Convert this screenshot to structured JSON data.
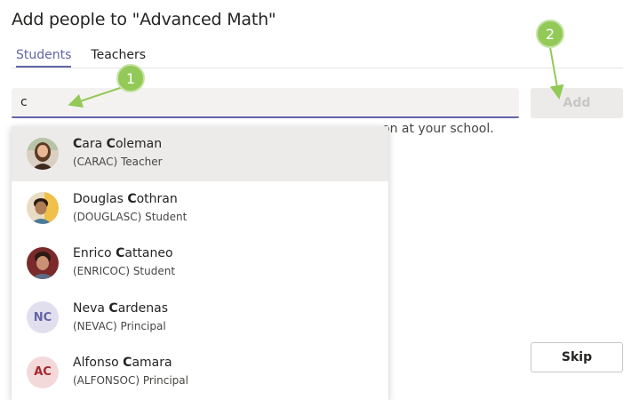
{
  "dialog": {
    "title": "Add people to \"Advanced Math\""
  },
  "tabs": [
    {
      "label": "Students",
      "active": true
    },
    {
      "label": "Teachers",
      "active": false
    }
  ],
  "search": {
    "value": "c",
    "placeholder": ""
  },
  "buttons": {
    "add": "Add",
    "skip": "Skip"
  },
  "hint_text": "on at your school.",
  "suggestions": [
    {
      "name_match": "C",
      "name_rest1": "ara ",
      "name_match2": "C",
      "name_rest2": "oleman",
      "subtitle": "(CARAC) Teacher",
      "avatar": "photo",
      "highlighted": true
    },
    {
      "name_match": "",
      "name_rest1": "Douglas ",
      "name_match2": "C",
      "name_rest2": "othran",
      "subtitle": "(DOUGLASC) Student",
      "avatar": "photo"
    },
    {
      "name_match": "",
      "name_rest1": "Enrico ",
      "name_match2": "C",
      "name_rest2": "attaneo",
      "subtitle": "(ENRICOC) Student",
      "avatar": "photo"
    },
    {
      "name_match": "",
      "name_rest1": "Neva ",
      "name_match2": "C",
      "name_rest2": "ardenas",
      "subtitle": "(NEVAC) Principal",
      "avatar": "initials",
      "initials": "NC"
    },
    {
      "name_match": "",
      "name_rest1": "Alfonso ",
      "name_match2": "C",
      "name_rest2": "amara",
      "subtitle": "(ALFONSOC) Principal",
      "avatar": "initials",
      "initials": "AC"
    }
  ],
  "callouts": [
    "1",
    "2"
  ],
  "colors": {
    "accent": "#6264a7",
    "callout": "#92c957",
    "avatar_nc_bg": "#e1dfee",
    "avatar_nc_fg": "#6264a7",
    "avatar_ac_bg": "#f4d9da",
    "avatar_ac_fg": "#a4262c"
  }
}
